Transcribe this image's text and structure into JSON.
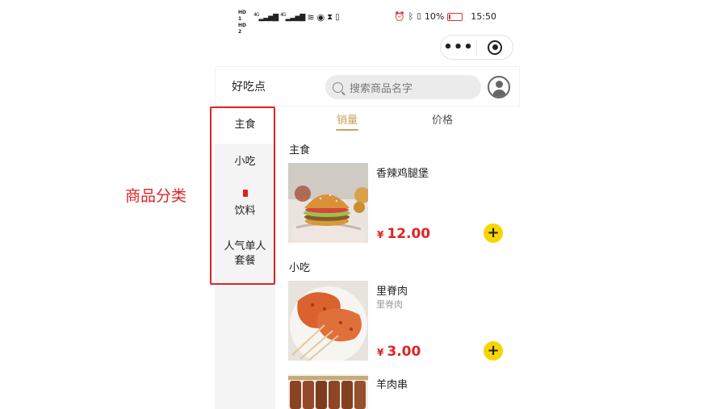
{
  "status_bar": {
    "sim1": "HD 1",
    "sim2": "HD 2",
    "net1": "4G",
    "net2": "4G",
    "battery_percent": "10%",
    "time": "15:50"
  },
  "capsule": {
    "more_icon": "more-dots-icon",
    "close_icon": "target-icon"
  },
  "header": {
    "title": "好吃点",
    "search_placeholder": "搜索商品名字"
  },
  "categories": [
    {
      "label": "主食",
      "active": true
    },
    {
      "label": "小吃"
    },
    {
      "label": "饮料",
      "icon": "drink-can-icon"
    },
    {
      "label": "人气单人套餐"
    }
  ],
  "annotation": "商品分类",
  "sort_tabs": [
    {
      "label": "销量",
      "active": true
    },
    {
      "label": "价格"
    }
  ],
  "sections": [
    {
      "title": "主食",
      "products": [
        {
          "name": "香辣鸡腿堡",
          "desc": "",
          "currency": "¥",
          "price": "12.00",
          "image": "burger-photo"
        }
      ]
    },
    {
      "title": "小吃",
      "products": [
        {
          "name": "里脊肉",
          "desc": "里脊肉",
          "currency": "¥",
          "price": "3.00",
          "image": "grilled-tenderloin-photo"
        },
        {
          "name": "羊肉串",
          "desc": "",
          "currency": "¥",
          "price": "",
          "image": "lamb-skewer-photo"
        }
      ]
    }
  ],
  "colors": {
    "accent_gold": "#c8a45a",
    "price_red": "#e02424",
    "add_button_yellow": "#f7d500",
    "annotation_red": "#e02424",
    "sidebar_bg": "#f4f4f4"
  }
}
